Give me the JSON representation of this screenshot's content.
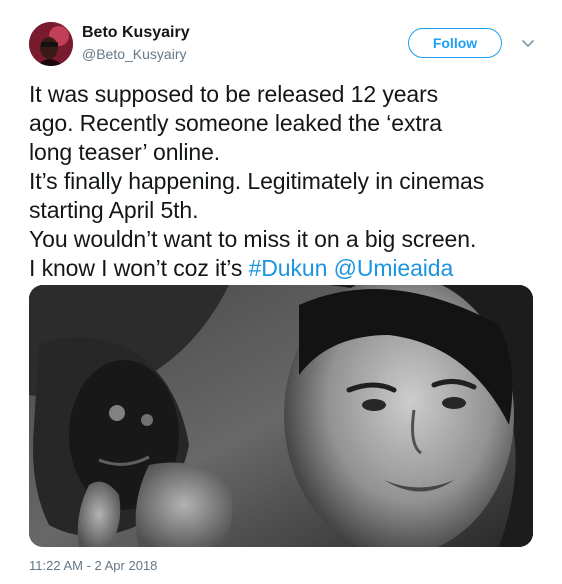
{
  "user": {
    "name": "Beto Kusyairy",
    "handle": "@Beto_Kusyairy"
  },
  "follow_label": "Follow",
  "tweet": {
    "line1": "It was supposed to be released 12 years",
    "line2": "ago. Recently someone leaked the ‘extra",
    "line3": "long teaser’ online.",
    "line4": "It’s finally happening. Legitimately in cinemas",
    "line5": "starting April 5th.",
    "line6": "You wouldn’t want to miss it on a big screen.",
    "line7_prefix": "I know I won’t coz it’s ",
    "hashtag": "#Dukun",
    "line7_space": " ",
    "mention": "@Umieaida"
  },
  "timestamp": "11:22 AM - 2 Apr 2018",
  "icons": {
    "caret": "chevron-down-icon",
    "avatar": "avatar"
  },
  "colors": {
    "accent": "#1da1f2",
    "link": "#1b95e0",
    "secondary_text": "#657786",
    "primary_text": "#14171a"
  }
}
